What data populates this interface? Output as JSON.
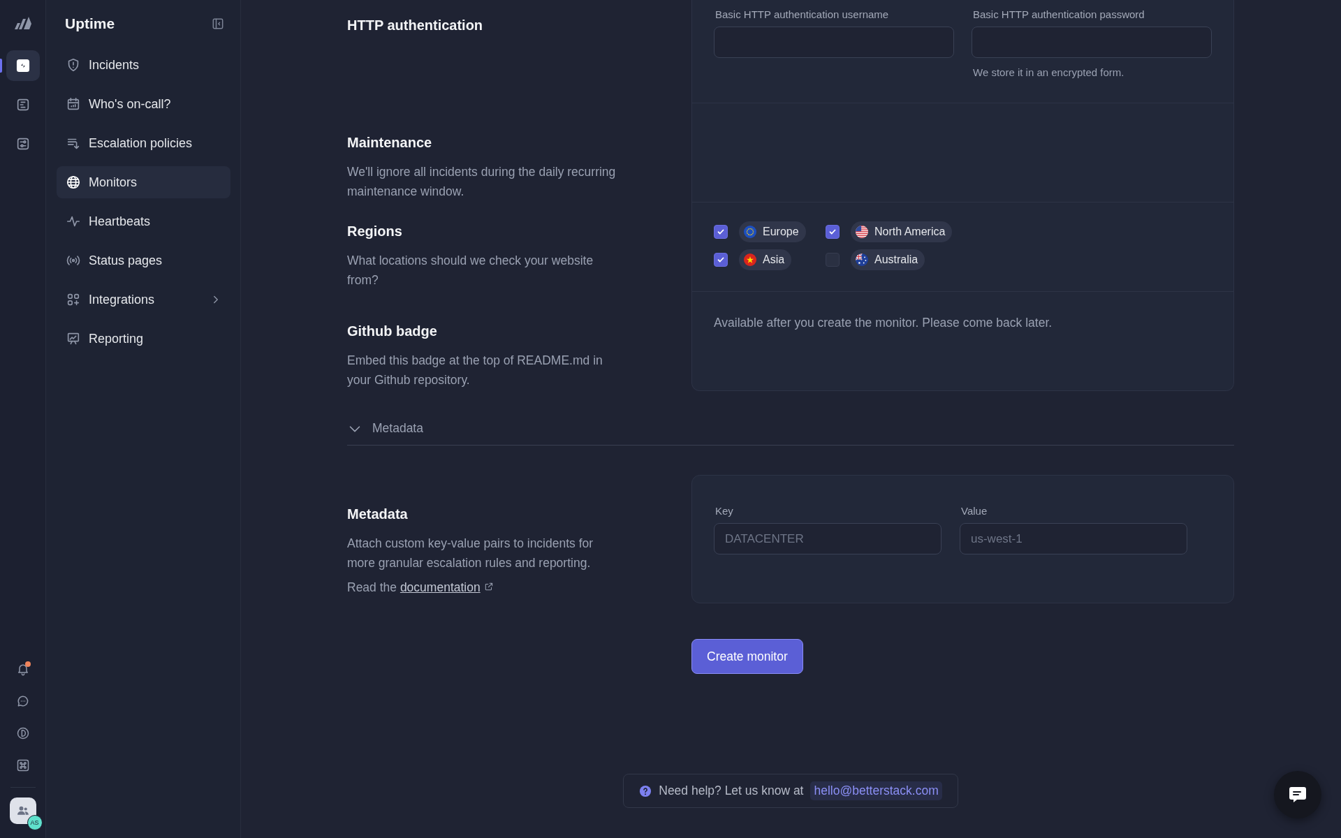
{
  "rail": {
    "items": [
      {
        "kind": "bolt",
        "selected": true
      },
      {
        "kind": "list",
        "selected": false
      },
      {
        "kind": "sliders",
        "selected": false
      }
    ],
    "bottom_items": [
      {
        "kind": "bell",
        "badge": true
      },
      {
        "kind": "chat",
        "badge": false
      },
      {
        "kind": "d-circle",
        "badge": false
      },
      {
        "kind": "command",
        "badge": false
      }
    ],
    "avatar": {
      "initials": "AS"
    }
  },
  "sidebar": {
    "title": "Uptime",
    "items": [
      {
        "label": "Incidents",
        "kind": "shield",
        "selected": false,
        "has_submenu": false
      },
      {
        "label": "Who's on-call?",
        "kind": "calendar",
        "selected": false,
        "has_submenu": false
      },
      {
        "label": "Escalation policies",
        "kind": "escalation",
        "selected": false,
        "has_submenu": false
      },
      {
        "label": "Monitors",
        "kind": "globe",
        "selected": true,
        "has_submenu": false
      },
      {
        "label": "Heartbeats",
        "kind": "heartbeat",
        "selected": false,
        "has_submenu": false
      },
      {
        "label": "Status pages",
        "kind": "broadcast",
        "selected": false,
        "has_submenu": false
      },
      {
        "label": "Integrations",
        "kind": "integrations",
        "selected": false,
        "has_submenu": true
      },
      {
        "label": "Reporting",
        "kind": "reporting",
        "selected": false,
        "has_submenu": false
      }
    ]
  },
  "http_auth": {
    "title": "HTTP authentication",
    "username": {
      "label": "Basic HTTP authentication username"
    },
    "password": {
      "label": "Basic HTTP authentication password",
      "hint": "We store it in an encrypted form."
    }
  },
  "maintenance": {
    "title": "Maintenance",
    "description": "We'll ignore all incidents during the daily recurring maintenance window."
  },
  "regions": {
    "title": "Regions",
    "description": "What locations should we check your website from?",
    "options": [
      {
        "label": "Europe",
        "kind": "eu",
        "checked": true
      },
      {
        "label": "North America",
        "kind": "us",
        "checked": true
      },
      {
        "label": "Asia",
        "kind": "asia",
        "checked": true
      },
      {
        "label": "Australia",
        "kind": "au",
        "checked": false
      }
    ]
  },
  "github_badge": {
    "title": "Github badge",
    "description": "Embed this badge at the top of README.md in your Github repository.",
    "note": "Available after you create the monitor. Please come back later."
  },
  "metadata_toggle": {
    "label": "Metadata",
    "expanded": true
  },
  "metadata": {
    "title": "Metadata",
    "description": "Attach custom key-value pairs to incidents for more granular escalation rules and reporting.",
    "link_prefix": "Read the",
    "link": "documentation",
    "fields": [
      {
        "label": "Key",
        "placeholder": "DATACENTER"
      },
      {
        "label": "Value",
        "placeholder": "us-west-1"
      }
    ]
  },
  "submit": "Create monitor",
  "help": {
    "text": "Need help? Let us know at",
    "email": "hello@betterstack.com"
  }
}
